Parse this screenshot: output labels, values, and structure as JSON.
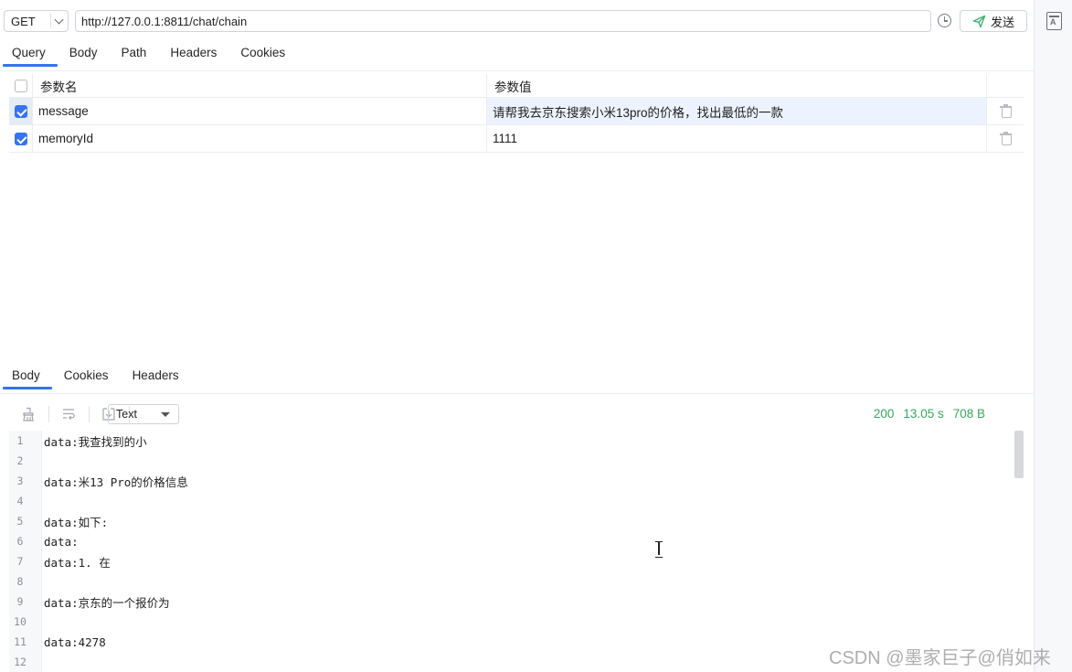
{
  "request": {
    "method": "GET",
    "url": "http://127.0.0.1:8811/chat/chain",
    "send_label": "发送"
  },
  "request_tabs": [
    {
      "label": "Query",
      "active": true
    },
    {
      "label": "Body",
      "active": false
    },
    {
      "label": "Path",
      "active": false
    },
    {
      "label": "Headers",
      "active": false
    },
    {
      "label": "Cookies",
      "active": false
    }
  ],
  "params": {
    "header": {
      "name": "参数名",
      "value": "参数值"
    },
    "rows": [
      {
        "checked": true,
        "name": "message",
        "value": "请帮我去京东搜索小米13pro的价格，找出最低的一款"
      },
      {
        "checked": true,
        "name": "memoryId",
        "value": "1111"
      }
    ]
  },
  "response_tabs": [
    {
      "label": "Body",
      "active": true
    },
    {
      "label": "Cookies",
      "active": false
    },
    {
      "label": "Headers",
      "active": false
    }
  ],
  "response": {
    "format": "Text",
    "status_code": "200",
    "time": "13.05 s",
    "size": "708 B",
    "lines": [
      {
        "n": "1",
        "text": "data:我查找到的小"
      },
      {
        "n": "2",
        "text": ""
      },
      {
        "n": "3",
        "text": "data:米13 Pro的价格信息"
      },
      {
        "n": "4",
        "text": ""
      },
      {
        "n": "5",
        "text": "data:如下:"
      },
      {
        "n": "6",
        "text": "data:"
      },
      {
        "n": "7",
        "text": "data:1. 在"
      },
      {
        "n": "8",
        "text": ""
      },
      {
        "n": "9",
        "text": "data:京东的一个报价为"
      },
      {
        "n": "10",
        "text": ""
      },
      {
        "n": "11",
        "text": "data:4278"
      },
      {
        "n": "12",
        "text": ""
      }
    ]
  },
  "icons": {
    "history": "clock-icon",
    "send": "paper-plane-icon",
    "clear": "broom-icon",
    "wrap": "wrap-lines-icon",
    "download": "download-icon",
    "delete": "trash-icon",
    "sidebar": "translate-panel-icon"
  },
  "colors": {
    "accent": "#3574f0",
    "success": "#35a85e"
  },
  "watermark": "CSDN @墨家巨子@俏如来"
}
